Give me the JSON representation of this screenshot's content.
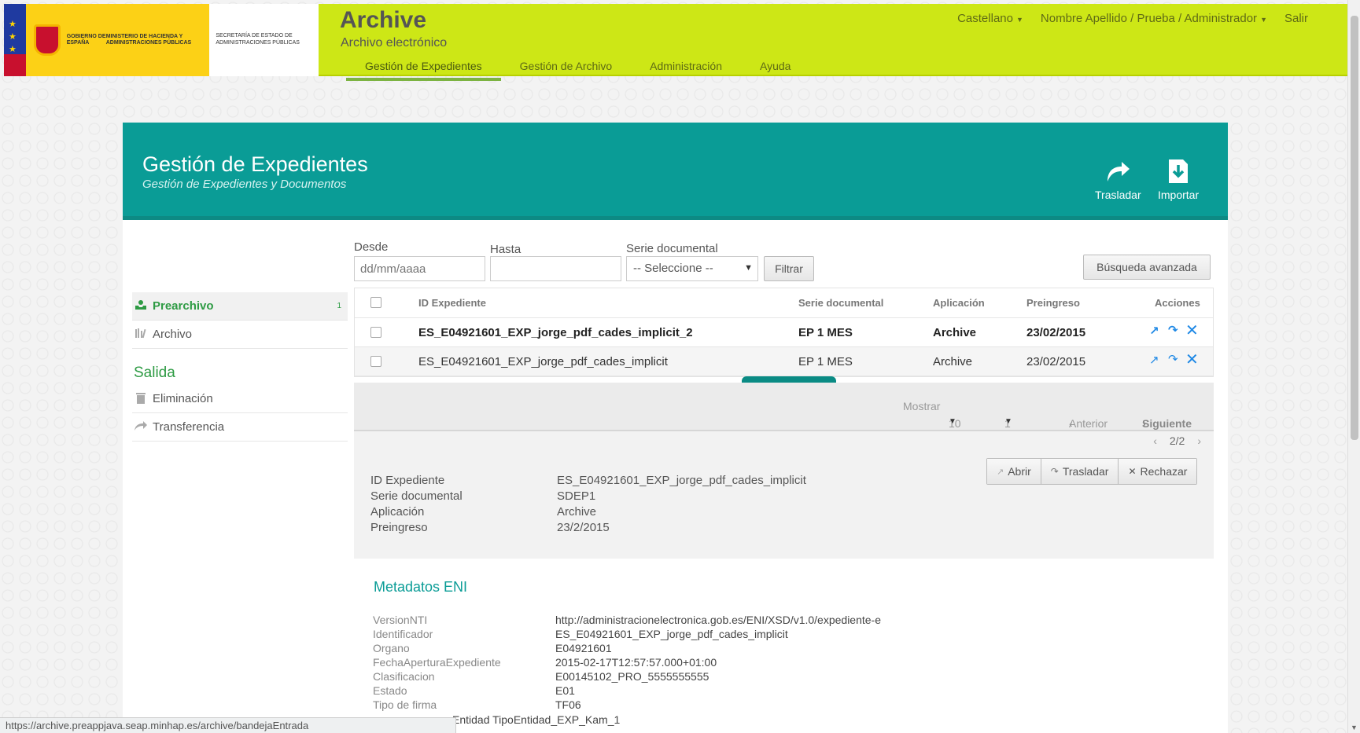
{
  "header": {
    "gov": {
      "gobierno": "GOBIERNO DE ESPAÑA",
      "ministerio": "MINISTERIO DE HACIENDA Y ADMINISTRACIONES PÚBLICAS",
      "secretaria": "SECRETARÍA DE ESTADO DE ADMINISTRACIONES PÚBLICAS"
    },
    "app_title": "Archive",
    "app_subtitle": "Archivo electrónico",
    "language": "Castellano",
    "user": "Nombre Apellido / Prueba / Administrador",
    "logout": "Salir",
    "nav": [
      "Gestión de Expedientes",
      "Gestión de Archivo",
      "Administración",
      "Ayuda"
    ]
  },
  "panel": {
    "title": "Gestión de Expedientes",
    "subtitle": "Gestión de Expedientes y Documentos",
    "actions": {
      "trasladar": "Trasladar",
      "importar": "Importar"
    }
  },
  "sidebar": {
    "items": [
      {
        "label": "Prearchivo",
        "count": "1",
        "icon": "inbox-icon"
      },
      {
        "label": "Archivo",
        "icon": "books-icon"
      }
    ],
    "section": "Salida",
    "section_items": [
      {
        "label": "Eliminación",
        "icon": "trash-icon"
      },
      {
        "label": "Transferencia",
        "icon": "forward-icon"
      }
    ]
  },
  "filters": {
    "desde_label": "Desde",
    "desde_placeholder": "dd/mm/aaaa",
    "hasta_label": "Hasta",
    "hasta_value": "",
    "serie_label": "Serie documental",
    "serie_value": "-- Seleccione --",
    "filtrar": "Filtrar",
    "busqueda_avanzada": "Búsqueda avanzada"
  },
  "table": {
    "columns": [
      "ID Expediente",
      "Serie documental",
      "Aplicación",
      "Preingreso",
      "Acciones"
    ],
    "rows": [
      {
        "id": "ES_E04921601_EXP_jorge_pdf_cades_implicit_2",
        "serie": "EP 1 MES",
        "aplicacion": "Archive",
        "preingreso": "23/02/2015"
      },
      {
        "id": "ES_E04921601_EXP_jorge_pdf_cades_implicit",
        "serie": "EP 1 MES",
        "aplicacion": "Archive",
        "preingreso": "23/02/2015"
      }
    ]
  },
  "pager": {
    "mostrar_label": "Mostrar",
    "mostrar_value": "10",
    "page": "1 / 2",
    "anterior": "Anterior",
    "siguiente": "Siguiente"
  },
  "detail": {
    "nav": "2/2",
    "actions": {
      "abrir": "Abrir",
      "trasladar": "Trasladar",
      "rechazar": "Rechazar"
    },
    "fields": [
      {
        "label": "ID Expediente",
        "value": "ES_E04921601_EXP_jorge_pdf_cades_implicit"
      },
      {
        "label": "Serie documental",
        "value": "SDEP1"
      },
      {
        "label": "Aplicación",
        "value": "Archive"
      },
      {
        "label": "Preingreso",
        "value": "23/2/2015"
      }
    ]
  },
  "metadata": {
    "title": "Metadatos ENI",
    "fields": [
      {
        "label": "VersionNTI",
        "value": "http://administracionelectronica.gob.es/ENI/XSD/v1.0/expediente-e"
      },
      {
        "label": "Identificador",
        "value": "ES_E04921601_EXP_jorge_pdf_cades_implicit"
      },
      {
        "label": "Organo",
        "value": "E04921601"
      },
      {
        "label": "FechaAperturaExpediente",
        "value": "2015-02-17T12:57:57.000+01:00"
      },
      {
        "label": "Clasificacion",
        "value": "E00145102_PRO_5555555555"
      },
      {
        "label": "Estado",
        "value": "E01"
      },
      {
        "label": "Tipo de firma",
        "value": "TF06"
      }
    ],
    "partial_line": "Entidad TipoEntidad_EXP_Kam_1"
  },
  "statusbar": "https://archive.preappjava.seap.minhap.es/archive/bandejaEntrada",
  "colors": {
    "header_bg": "#cde716",
    "panel_accent": "#0a9c96",
    "link_green": "#2e9b44",
    "action_blue": "#1e88e5"
  }
}
